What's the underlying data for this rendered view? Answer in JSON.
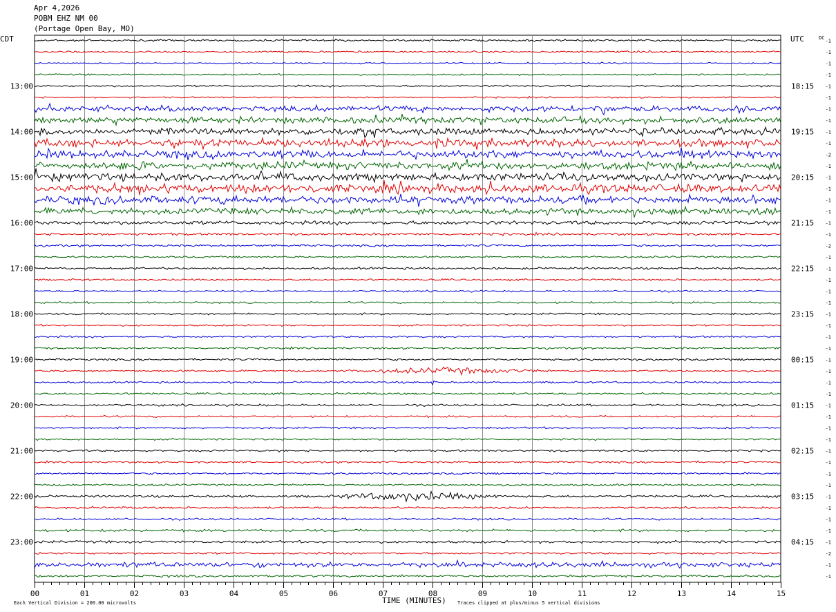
{
  "header": {
    "date": "Apr 4,2026",
    "station": "POBM EHZ NM 00",
    "location": "(Portage Open Bay, MO)"
  },
  "chart_data": {
    "type": "line",
    "subtype": "helicorder",
    "left_tz_label": "CDT",
    "right_tz_label": "UTC",
    "dc_label": "DC",
    "xlabel": "TIME (MINUTES)",
    "x_ticks": [
      "00",
      "01",
      "02",
      "03",
      "04",
      "05",
      "06",
      "07",
      "08",
      "09",
      "10",
      "11",
      "12",
      "13",
      "14",
      "15"
    ],
    "xlim": [
      0,
      15
    ],
    "left_time_labels": [
      "13:00",
      "14:00",
      "15:00",
      "16:00",
      "17:00",
      "18:00",
      "19:00",
      "20:00",
      "21:00",
      "22:00",
      "23:00"
    ],
    "right_time_labels": [
      "18:15",
      "19:15",
      "20:15",
      "21:15",
      "22:15",
      "23:15",
      "00:15",
      "01:15",
      "02:15",
      "03:15",
      "04:15"
    ],
    "first_labeled_row": 4,
    "rows_per_label": 4,
    "trace_colors": [
      "#000000",
      "#e00000",
      "#0000d8",
      "#006400"
    ],
    "dc_offsets": [
      -1,
      -1,
      -1,
      -1,
      -1,
      -1,
      -1,
      -1,
      -1,
      -1,
      -2,
      -1,
      -1,
      -1,
      -1,
      -1,
      -1,
      -1,
      -2,
      -1,
      -1,
      -1,
      -1,
      -1,
      -1,
      -1,
      -1,
      -1,
      -1,
      -1,
      -1,
      -1,
      -1,
      -1,
      -1,
      -1,
      -1,
      -1,
      -1,
      -1,
      -1,
      -1,
      -1,
      -1,
      -1,
      -2,
      -1,
      -1,
      -1,
      -1,
      -1,
      -1,
      -1,
      -1,
      -1,
      -1,
      -1,
      -1,
      -1,
      -1,
      -1,
      -1,
      -1,
      -1,
      -1,
      -1,
      -1,
      -1,
      -1,
      -1,
      -1,
      -1
    ],
    "noise_levels": [
      1.3,
      1.2,
      1.0,
      1.0,
      1.2,
      1.0,
      3.5,
      4.0,
      4.5,
      5.0,
      5.0,
      5.0,
      5.0,
      5.5,
      5.0,
      4.0,
      2.5,
      1.6,
      1.4,
      1.2,
      1.4,
      1.2,
      1.2,
      1.2,
      1.2,
      1.1,
      1.2,
      1.3,
      1.3,
      1.2,
      1.2,
      1.3,
      1.4,
      1.2,
      1.2,
      1.1,
      1.3,
      1.2,
      1.3,
      1.2,
      1.5,
      1.3,
      1.3,
      1.6,
      1.6,
      1.3,
      3.2,
      1.4,
      1.4,
      1.4,
      1.4,
      1.2,
      1.3,
      1.3,
      1.3
    ],
    "events": [
      {
        "row": 29,
        "start_min": 6.2,
        "end_min": 10.5,
        "peak_min": 8.3,
        "amplitude": 3.5
      },
      {
        "row": 40,
        "start_min": 6.0,
        "end_min": 9.5,
        "peak_min": 7.6,
        "amplitude": 5.5
      },
      {
        "row": 6,
        "start_min": 11.2,
        "end_min": 11.6,
        "peak_min": 11.4,
        "amplitude": 7.0
      },
      {
        "row": 8,
        "start_min": 12.1,
        "end_min": 12.35,
        "peak_min": 12.2,
        "amplitude": 6.0
      },
      {
        "row": 30,
        "start_min": 7.95,
        "end_min": 8.05,
        "peak_min": 8.0,
        "amplitude": 4.0
      }
    ],
    "footer_left": "Each Vertical Division =  200.00 microvolts",
    "footer_right": "Traces clipped at plus/minus 5 vertical divisions"
  }
}
